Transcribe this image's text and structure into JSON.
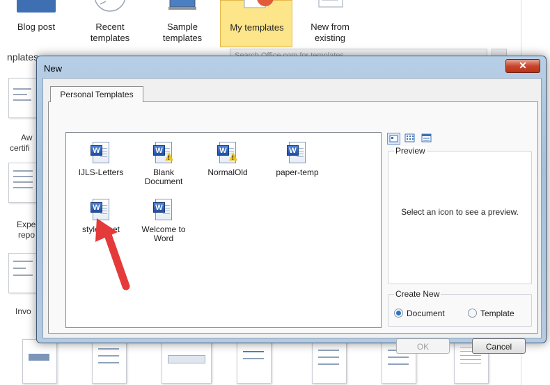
{
  "background": {
    "top_templates": [
      {
        "label": "Blog post",
        "selected": false
      },
      {
        "label": "Recent templates",
        "selected": false
      },
      {
        "label": "Sample templates",
        "selected": false
      },
      {
        "label": "My templates",
        "selected": true
      },
      {
        "label": "New from existing",
        "selected": false
      }
    ],
    "section_label": "nplates",
    "search_placeholder": "Search Office.com for templates",
    "side_labels": [
      "Aw",
      "certifi",
      "Expe",
      "repo",
      "Invo"
    ]
  },
  "dialog": {
    "title": "New",
    "close_label": "✕",
    "tab_label": "Personal Templates",
    "templates": [
      {
        "label": "IJLS-Letters",
        "warning": false
      },
      {
        "label": "Blank Document",
        "warning": true
      },
      {
        "label": "NormalOld",
        "warning": true
      },
      {
        "label": "paper-temp",
        "warning": false
      },
      {
        "label": "stylesheet",
        "warning": false
      },
      {
        "label": "Welcome to Word",
        "warning": false
      }
    ],
    "view_buttons": [
      "large-icons-view-icon",
      "list-view-icon",
      "details-view-icon"
    ],
    "preview": {
      "label": "Preview",
      "text": "Select an icon to see a preview."
    },
    "create_new": {
      "label": "Create New",
      "options": [
        {
          "label": "Document",
          "selected": true
        },
        {
          "label": "Template",
          "selected": false
        }
      ]
    },
    "buttons": {
      "ok": "OK",
      "cancel": "Cancel"
    }
  },
  "colors": {
    "selected_tile": "#fde58a",
    "dialog_frame": "#b7cfe6",
    "close_button": "#c8462d",
    "arrow": "#e43a3a"
  }
}
